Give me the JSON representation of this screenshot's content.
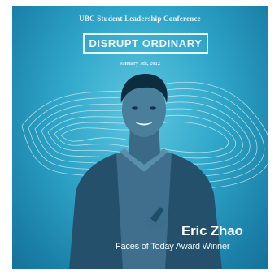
{
  "poster": {
    "conference": "UBC Student Leadership Conference",
    "title": "DISRUPT ORDINARY",
    "date": "January 7th, 2012",
    "name": "Eric Zhao",
    "award": "Faces of Today Award Winner"
  },
  "colors": {
    "background_center": "#5fc7e0",
    "background_edge": "#16729a",
    "text": "#ffffff",
    "shirt": "#3f6f8c",
    "cardigan": "#24506b"
  }
}
